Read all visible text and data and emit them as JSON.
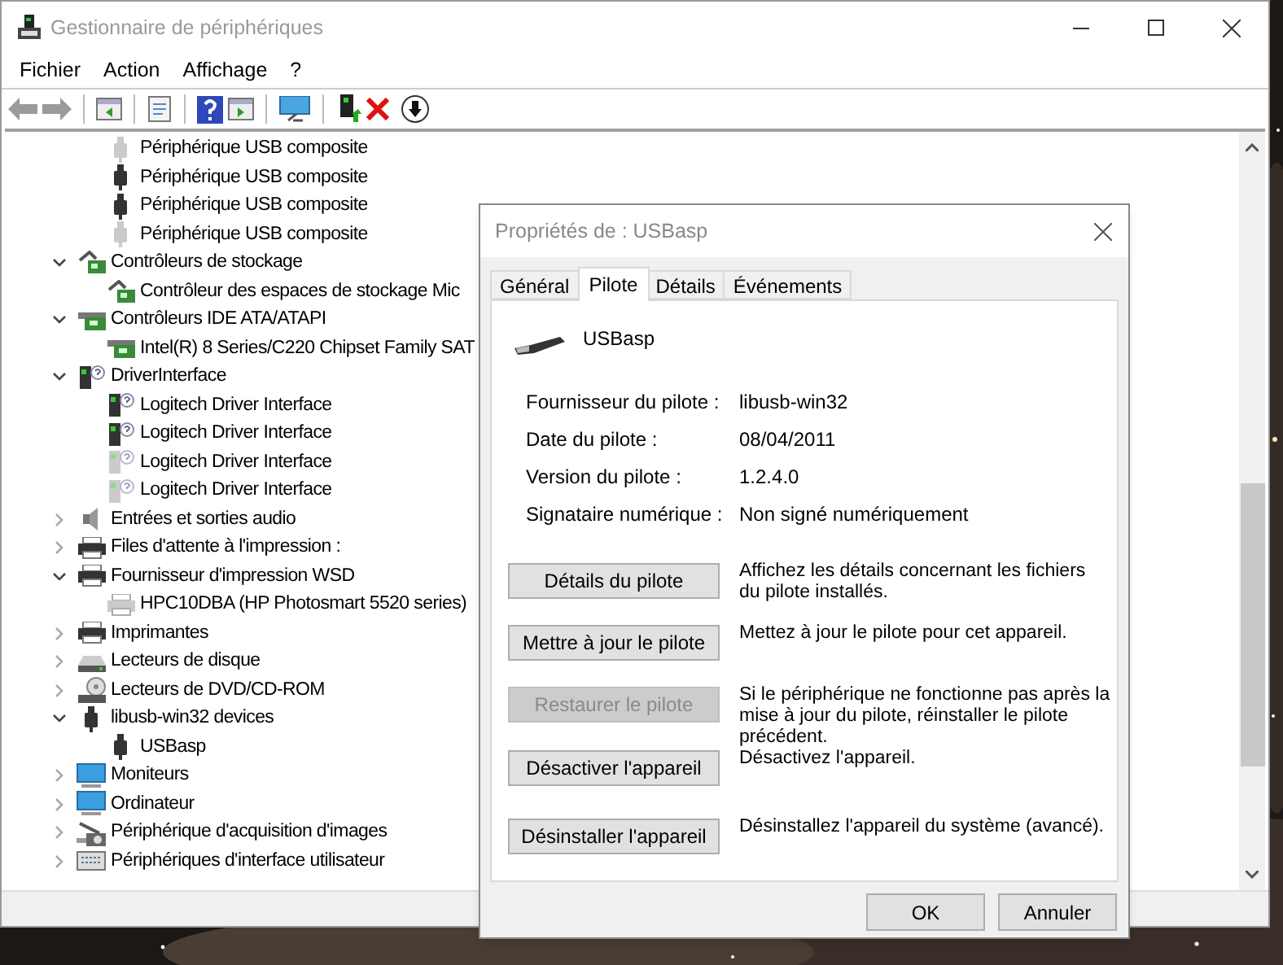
{
  "window": {
    "title": "Gestionnaire de périphériques"
  },
  "menu": [
    "Fichier",
    "Action",
    "Affichage",
    "?"
  ],
  "tree": [
    {
      "children": [
        {
          "label": "Périphérique USB composite",
          "kind": "usb",
          "disconnected": true
        },
        {
          "label": "Périphérique USB composite",
          "kind": "usb",
          "disconnected": false
        },
        {
          "label": "Périphérique USB composite",
          "kind": "usb",
          "disconnected": false
        },
        {
          "label": "Périphérique USB composite",
          "kind": "usb",
          "disconnected": true
        }
      ]
    },
    {
      "label": "Contrôleurs de stockage",
      "kind": "storage",
      "expanded": true,
      "children": [
        {
          "label": "Contrôleur des espaces de stockage Mic",
          "kind": "storage",
          "disconnected": false
        }
      ]
    },
    {
      "label": "Contrôleurs IDE ATA/ATAPI",
      "kind": "ide",
      "expanded": true,
      "children": [
        {
          "label": "Intel(R) 8 Series/C220 Chipset Family SAT",
          "kind": "ide",
          "disconnected": false
        }
      ]
    },
    {
      "label": "DriverInterface",
      "kind": "driver",
      "expanded": true,
      "children": [
        {
          "label": "Logitech Driver Interface",
          "kind": "driver",
          "disconnected": false
        },
        {
          "label": "Logitech Driver Interface",
          "kind": "driver",
          "disconnected": false
        },
        {
          "label": "Logitech Driver Interface",
          "kind": "driver",
          "disconnected": true
        },
        {
          "label": "Logitech Driver Interface",
          "kind": "driver",
          "disconnected": true
        }
      ]
    },
    {
      "label": "Entrées et sorties audio",
      "kind": "audio",
      "expanded": false
    },
    {
      "label": "Files d'attente à l'impression :",
      "kind": "printer",
      "expanded": false
    },
    {
      "label": "Fournisseur d'impression WSD",
      "kind": "printer",
      "expanded": true,
      "children": [
        {
          "label": "HPC10DBA (HP Photosmart 5520 series)",
          "kind": "printer",
          "disconnected": true
        }
      ]
    },
    {
      "label": "Imprimantes",
      "kind": "printer",
      "expanded": false
    },
    {
      "label": "Lecteurs de disque",
      "kind": "disk",
      "expanded": false
    },
    {
      "label": "Lecteurs de DVD/CD-ROM",
      "kind": "dvd",
      "expanded": false
    },
    {
      "label": "libusb-win32 devices",
      "kind": "usb",
      "expanded": true,
      "children": [
        {
          "label": "USBasp",
          "kind": "usb",
          "disconnected": false
        }
      ]
    },
    {
      "label": "Moniteurs",
      "kind": "monitor",
      "expanded": false
    },
    {
      "label": "Ordinateur",
      "kind": "monitor",
      "expanded": false
    },
    {
      "label": "Périphérique d'acquisition d'images",
      "kind": "camera",
      "expanded": false
    },
    {
      "label": "Périphériques d'interface utilisateur",
      "kind": "keyboard",
      "expanded": false
    }
  ],
  "dialog": {
    "title": "Propriétés de : USBasp",
    "tabs": [
      {
        "label": "Général",
        "selected": false
      },
      {
        "label": "Pilote",
        "selected": true
      },
      {
        "label": "Détails",
        "selected": false
      },
      {
        "label": "Événements",
        "selected": false
      }
    ],
    "device_name": "USBasp",
    "info": [
      {
        "label": "Fournisseur du pilote :",
        "value": "libusb-win32"
      },
      {
        "label": "Date du pilote :",
        "value": "08/04/2011"
      },
      {
        "label": "Version du pilote :",
        "value": "1.2.4.0"
      },
      {
        "label": "Signataire numérique :",
        "value": "Non signé numériquement"
      }
    ],
    "actions": [
      {
        "button": "Détails du pilote",
        "description": "Affichez les détails concernant les fichiers du pilote installés.",
        "disabled": false
      },
      {
        "button": "Mettre à jour le pilote",
        "description": "Mettez à jour le pilote pour cet appareil.",
        "disabled": false
      },
      {
        "button": "Restaurer le pilote",
        "description": "Si le périphérique ne fonctionne pas après la mise à jour du pilote, réinstaller le pilote précédent.",
        "disabled": true
      },
      {
        "button": "Désactiver l'appareil",
        "description": "Désactivez l'appareil.",
        "disabled": false
      },
      {
        "button": "Désinstaller l'appareil",
        "description": "Désinstallez l'appareil du système (avancé).",
        "disabled": false
      }
    ],
    "buttons": [
      "OK",
      "Annuler"
    ]
  }
}
